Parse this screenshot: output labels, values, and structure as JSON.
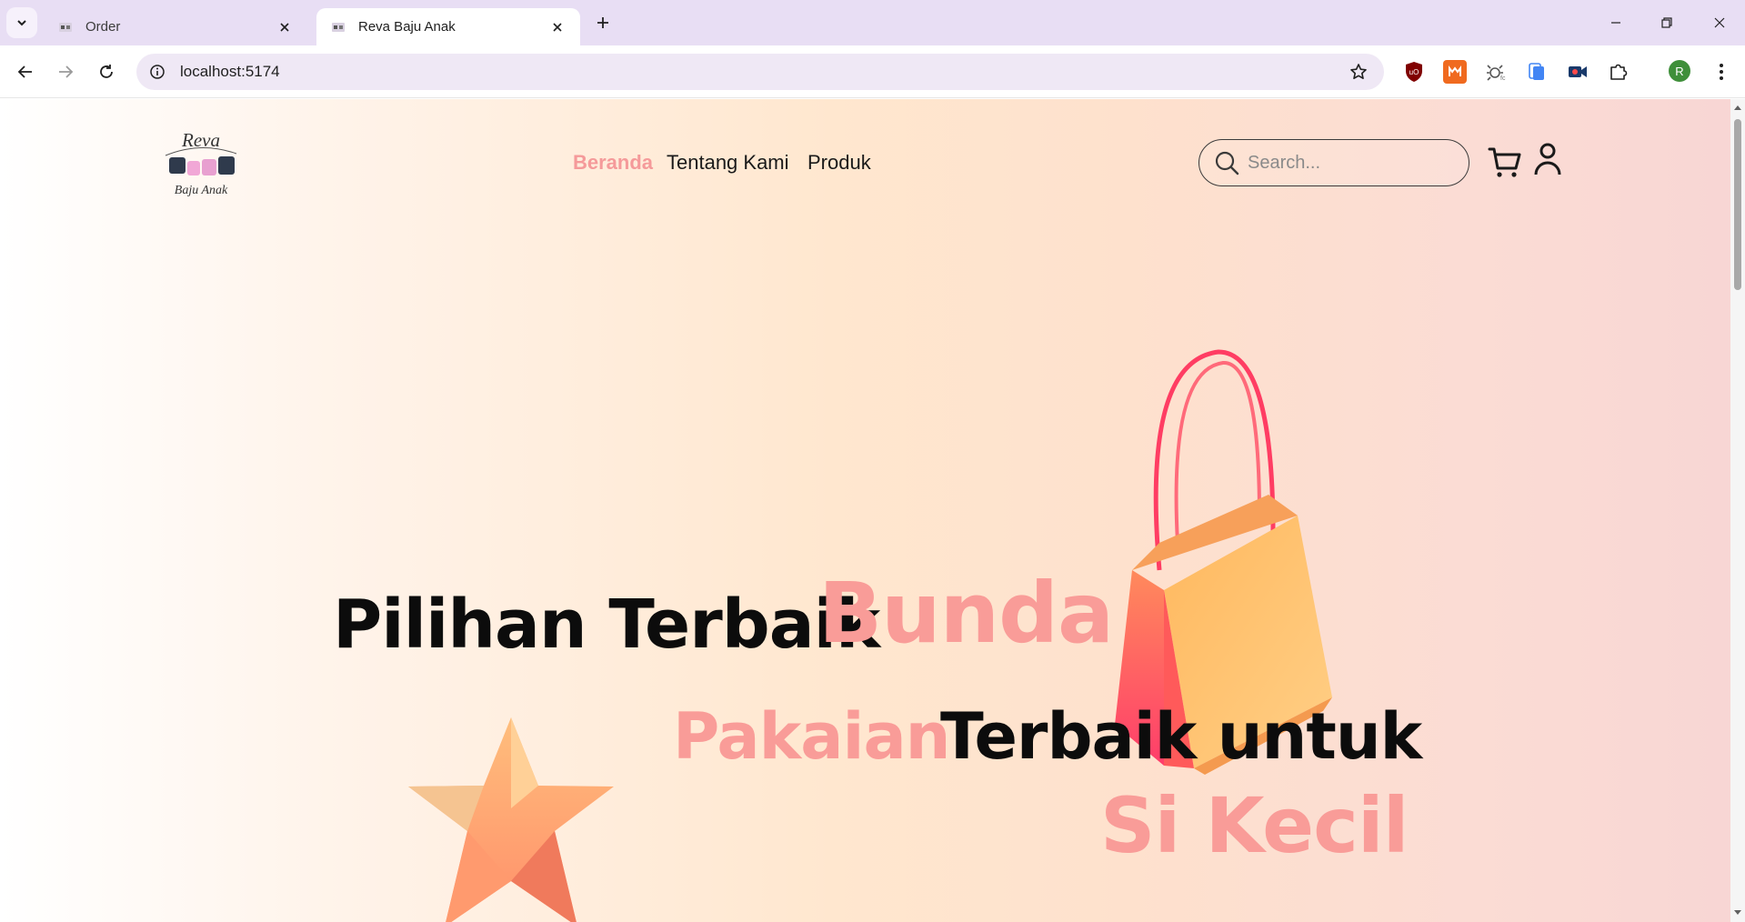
{
  "browser": {
    "tabs": [
      {
        "title": "Order",
        "active": false
      },
      {
        "title": "Reva Baju Anak",
        "active": true
      }
    ],
    "url": "localhost:5174",
    "profile_initial": "R",
    "colors": {
      "tabstrip": "#e8def4",
      "omnibox": "#efe8f5",
      "profile": "#3f8f3a"
    },
    "extensions": [
      "ublock-icon",
      "metamask-icon",
      "bug-icon",
      "docs-icon",
      "video-icon",
      "puzzle-icon"
    ]
  },
  "site": {
    "logo": {
      "line1": "Reva",
      "line2": "Baju Anak"
    },
    "nav": [
      {
        "label": "Beranda",
        "active": true
      },
      {
        "label": "Tentang Kami",
        "active": false
      },
      {
        "label": "Produk",
        "active": false
      }
    ],
    "search": {
      "placeholder": "Search..."
    },
    "hero": {
      "line1_a": "Pilihan Terbaik",
      "line1_b": "Bunda",
      "line2_a": "Pakaian",
      "line2_b": "Terbaik untuk",
      "line3": "Si Kecil"
    },
    "colors": {
      "accent": "#f99c98",
      "text": "#0c0c0c"
    }
  }
}
